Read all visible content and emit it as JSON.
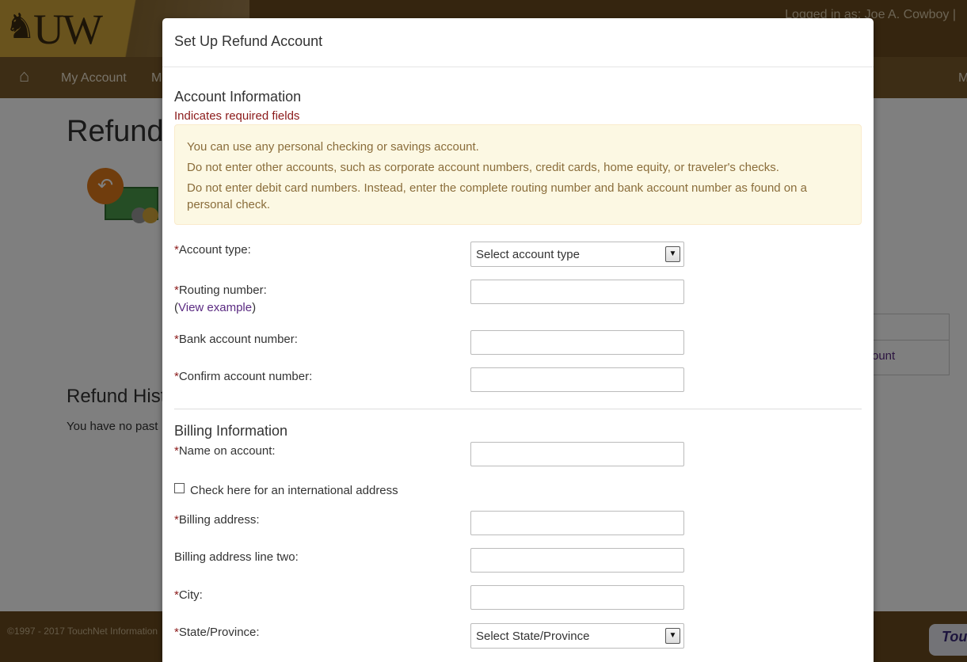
{
  "background": {
    "logo_text": "UW",
    "logged_in": "Logged in as: Joe A. Cowboy  |",
    "nav": [
      "My Account",
      "M",
      "M"
    ],
    "page_title": "Refunds",
    "table_link": "ount",
    "history_title": "Refund Hist",
    "history_text": "You have no past",
    "footer": "©1997 - 2017  TouchNet Information",
    "footer_logo": "Tou"
  },
  "modal": {
    "title": "Set Up Refund Account",
    "account_info": {
      "title": "Account Information",
      "required_note": "Indicates required fields",
      "alert": [
        "You can use any personal checking or savings account.",
        "Do not enter other accounts, such as corporate account numbers, credit cards, home equity, or traveler's checks.",
        "Do not enter debit card numbers. Instead, enter the complete routing number and bank account number as found on a personal check."
      ],
      "account_type_label": "Account type:",
      "account_type_value": "Select account type",
      "routing_label": "Routing number:",
      "view_example": "View example",
      "bank_account_label": "Bank account number:",
      "confirm_label": "Confirm account number:"
    },
    "billing_info": {
      "title": "Billing Information",
      "name_label": "Name on account:",
      "intl_label": "Check here for an international address",
      "address_label": "Billing address:",
      "address2_label": "Billing address line two:",
      "city_label": "City:",
      "state_label": "State/Province:",
      "state_value": "Select State/Province"
    },
    "required_marker": "*"
  }
}
